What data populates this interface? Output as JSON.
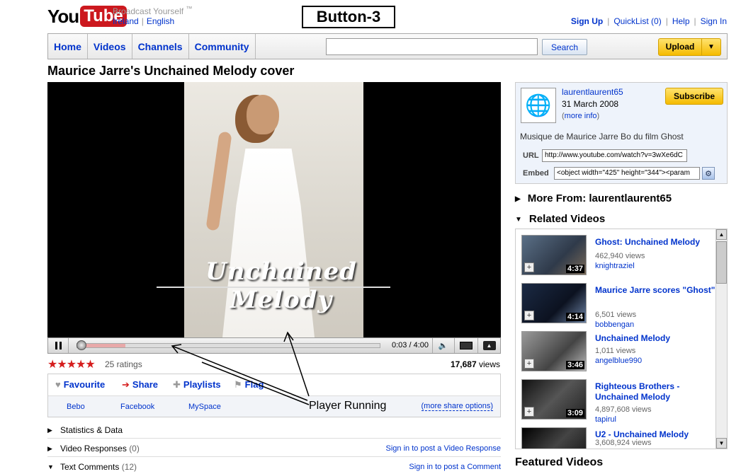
{
  "header": {
    "logo_you": "You",
    "logo_tube": "Tube",
    "tagline": "Broadcast Yourself",
    "tm": "™",
    "locale_country": "Ireland",
    "locale_language": "English",
    "annotation_title": "Button-3",
    "toplinks": {
      "signup": "Sign Up",
      "quicklist": "QuickList",
      "quicklist_count": "(0)",
      "help": "Help",
      "signin": "Sign In"
    }
  },
  "nav": {
    "tabs": [
      "Home",
      "Videos",
      "Channels",
      "Community"
    ],
    "search_value": "",
    "search_label": "Search",
    "upload_label": "Upload"
  },
  "video": {
    "title": "Maurice Jarre's Unchained Melody cover",
    "overlay_text": "Unchained Melody",
    "time": "0:03 / 4:00",
    "progress_played": 0.013,
    "progress_loaded": 0.16,
    "rating_stars": 5,
    "ratings": "25 ratings",
    "views_count": "17,687",
    "views_label": "views"
  },
  "actions": {
    "favourite": "Favourite",
    "share": "Share",
    "playlists": "Playlists",
    "flag": "Flag",
    "share_sites": [
      "Bebo",
      "Facebook",
      "MySpace"
    ],
    "more_share": "(more share options)"
  },
  "sections": [
    {
      "name": "Statistics & Data",
      "count": "",
      "right": ""
    },
    {
      "name": "Video Responses",
      "count": "(0)",
      "right": "Sign in to post a Video Response"
    },
    {
      "name": "Text Comments",
      "count": "(12)",
      "right": "Sign in to post a Comment"
    }
  ],
  "annotation_player": "Player Running",
  "channel": {
    "username": "laurentlaurent65",
    "date": "31 March 2008",
    "more_open": "(",
    "more_info": "more info",
    "more_close": ")",
    "subscribe": "Subscribe",
    "description": "Musique de Maurice Jarre Bo du film Ghost",
    "url_label": "URL",
    "url_value": "http://www.youtube.com/watch?v=3wXe6dC",
    "embed_label": "Embed",
    "embed_value": "<object width=\"425\" height=\"344\"><param"
  },
  "right": {
    "more_from": "More From: laurentlaurent65",
    "related_heading": "Related Videos",
    "featured": "Featured Videos"
  },
  "related": [
    {
      "title": "Ghost: Unchained Melody",
      "views": "462,940 views",
      "user": "knightraziel",
      "duration": "4:37"
    },
    {
      "title": "Maurice Jarre scores \"Ghost\"",
      "views": "6,501 views",
      "user": "bobbengan",
      "duration": "4:14"
    },
    {
      "title": "Unchained Melody",
      "views": "1,011 views",
      "user": "angelblue990",
      "duration": "3:46"
    },
    {
      "title": "Righteous Brothers - Unchained Melody",
      "views": "4,897,608 views",
      "user": "tapirul",
      "duration": "3:09"
    },
    {
      "title": "U2 - Unchained Melody",
      "views": "3,608,924 views",
      "user": "",
      "duration": ""
    }
  ]
}
